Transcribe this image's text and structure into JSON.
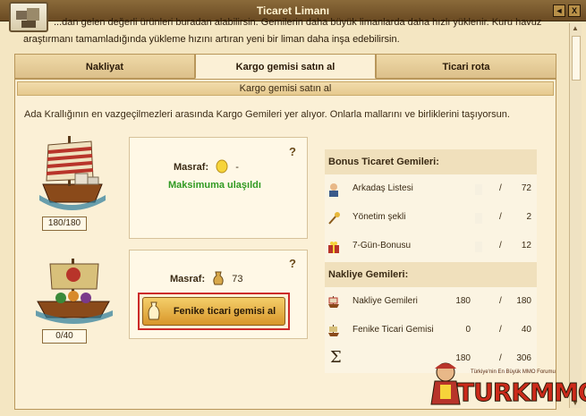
{
  "window": {
    "title": "Ticaret Limanı",
    "help_label": "◄",
    "close_label": "X"
  },
  "intro": {
    "line1": "...dan gelen değerli ürünleri buradan alabilirsin. Gemilerin daha büyük limanlarda daha hızlı yüklenir. Kuru havuz",
    "line2": "araştırmanı tamamladığında yükleme hızını artıran yeni bir liman daha inşa edebilirsin."
  },
  "tabs": [
    {
      "label": "Nakliyat",
      "active": false
    },
    {
      "label": "Kargo gemisi satın al",
      "active": true
    },
    {
      "label": "Ticari rota",
      "active": false
    }
  ],
  "panel": {
    "header": "Kargo gemisi satın al",
    "description": "Ada Krallığının en vazgeçilmezleri arasında Kargo Gemileri yer alıyor. Onlarla mallarını ve birliklerini taşıyorsun."
  },
  "cargo_ship": {
    "count": "180/180",
    "cost_label": "Masraf:",
    "cost_value": "-",
    "status": "Maksimuma ulaşıldı",
    "help": "?"
  },
  "phoenician_ship": {
    "count": "0/40",
    "cost_label": "Masraf:",
    "cost_value": "73",
    "button_label": "Fenike ticari gemisi al",
    "help": "?"
  },
  "bonus_ships": {
    "header": "Bonus Ticaret Gemileri:",
    "rows": [
      {
        "name": "Arkadaş Listesi",
        "current": "",
        "max": "72",
        "icon": "friends-icon"
      },
      {
        "name": "Yönetim şekli",
        "current": "",
        "max": "2",
        "icon": "scepter-icon"
      },
      {
        "name": "7-Gün-Bonusu",
        "current": "",
        "max": "12",
        "icon": "gift-icon"
      }
    ]
  },
  "transport_ships": {
    "header": "Nakliye Gemileri:",
    "rows": [
      {
        "name": "Nakliye Gemileri",
        "current": "180",
        "max": "180",
        "icon": "cargo-ship-icon"
      },
      {
        "name": "Fenike Ticari Gemisi",
        "current": "0",
        "max": "40",
        "icon": "phoenician-ship-icon"
      }
    ],
    "total": {
      "symbol": "Σ",
      "current": "180",
      "max": "306"
    }
  },
  "slash": "/",
  "brand": {
    "tagline": "Türkiye'nin En Büyük MMO Forumu",
    "wordmark": "TURKMMO"
  },
  "colors": {
    "accent_red": "#cc2a2a",
    "status_green": "#2f9a22",
    "button_gold": "#f4cf6a"
  }
}
